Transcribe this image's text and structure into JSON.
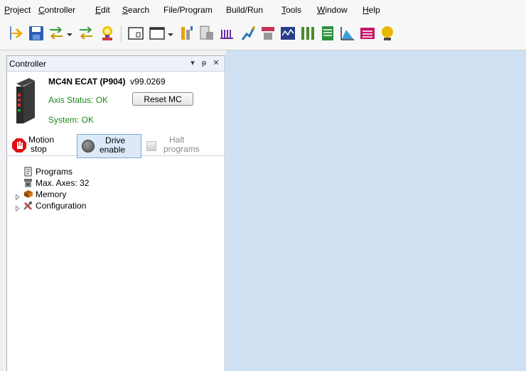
{
  "menu": [
    {
      "label": "Project",
      "u": "P",
      "rest": "roject"
    },
    {
      "label": "Controller",
      "u": "C",
      "rest": "ontroller"
    },
    {
      "label": "Edit",
      "u": "E",
      "rest": "dit"
    },
    {
      "label": "Search",
      "u": "S",
      "rest": "earch"
    },
    {
      "label": "File/Program",
      "pre": "File/Pro",
      "u": "g",
      "rest": "ram"
    },
    {
      "label": "Build/Run",
      "plain": "Build/Run"
    },
    {
      "label": "Tools",
      "u": "T",
      "rest": "ools"
    },
    {
      "label": "Window",
      "u": "W",
      "rest": "indow"
    },
    {
      "label": "Help",
      "u": "H",
      "rest": "elp"
    }
  ],
  "toolbar_icons": [
    "open-project-icon",
    "save-icon",
    "connect-icon",
    "network-icon",
    "help-icon",
    "terminal-icon",
    "window-icon",
    "program-wizard-icon",
    "program-icon",
    "scope-icon",
    "robot-icon",
    "axis-icon",
    "motor-icon",
    "io-icon",
    "table-icon",
    "chart-icon",
    "list-icon",
    "vr-icon"
  ],
  "panel": {
    "title": "Controller",
    "pin": "ᵃ",
    "controller_name": "MC4N ECAT (P904)",
    "version": "v99.0269",
    "axis_status": "Axis Status: OK",
    "reset_label": "Reset MC",
    "system_status": "System: OK",
    "motion_stop_line1": "Motion",
    "motion_stop_line2": "stop",
    "drive_enable_line1": "Drive",
    "drive_enable_line2": "enable",
    "halt_line1": "Halt",
    "halt_line2": "programs"
  },
  "tree": [
    {
      "label": "Programs",
      "icon": "programs-icon",
      "expandable": false
    },
    {
      "label": "Max. Axes: 32",
      "icon": "axes-icon",
      "expandable": false
    },
    {
      "label": "Memory",
      "icon": "memory-icon",
      "expandable": true
    },
    {
      "label": "Configuration",
      "icon": "configuration-icon",
      "expandable": true
    }
  ],
  "colors": {
    "workspace": "#cfe0f2",
    "status_ok": "#1a8a1a"
  }
}
